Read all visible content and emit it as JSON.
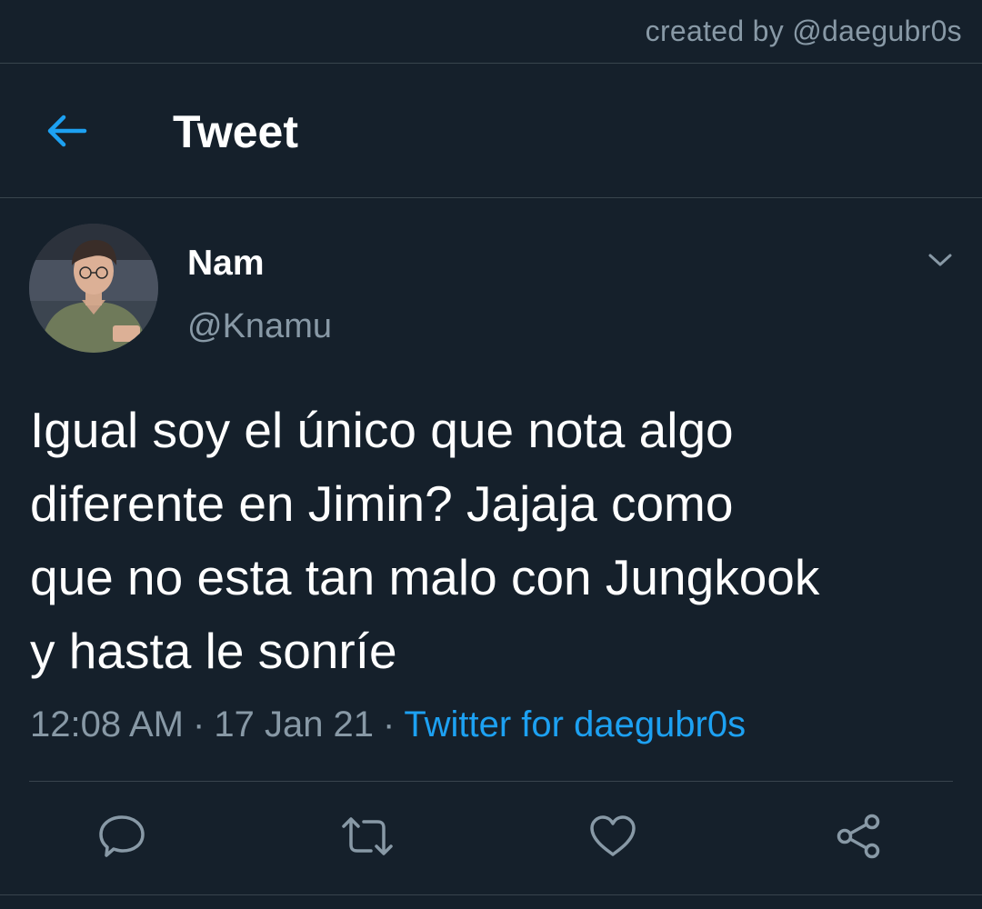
{
  "watermark": "created by @daegubr0s",
  "header": {
    "title": "Tweet",
    "back_icon": "arrow-left-icon"
  },
  "tweet": {
    "author": {
      "display_name": "Nam",
      "username": "@Knamu"
    },
    "text": "Igual soy el único que nota algo\ndiferente en Jimin? Jajaja como\nque no esta tan malo con Jungkook\ny hasta le sonríe",
    "time": "12:08 AM",
    "date": "17 Jan 21",
    "source": "Twitter for daegubr0s",
    "separator": "·"
  },
  "actions": [
    "reply-icon",
    "retweet-icon",
    "like-icon",
    "share-icon"
  ],
  "colors": {
    "background": "#15202b",
    "accent": "#1da1f2",
    "secondary_text": "#8899a6",
    "divider": "#38444d"
  }
}
